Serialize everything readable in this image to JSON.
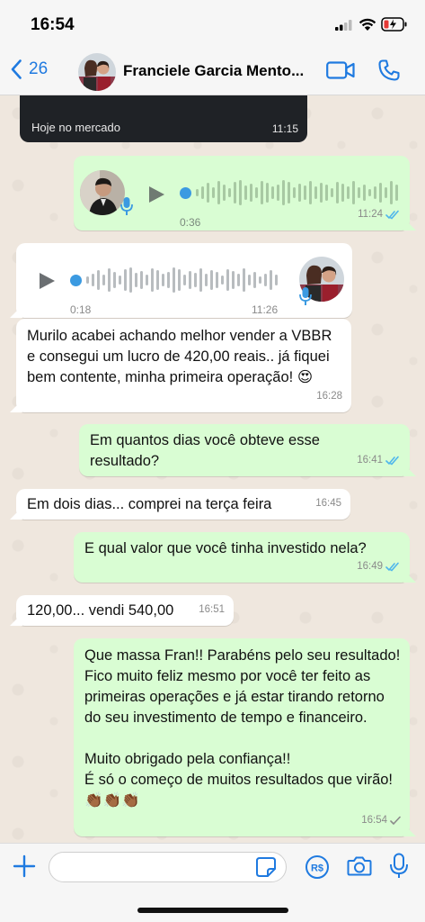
{
  "status_bar": {
    "time": "16:54"
  },
  "header": {
    "back_count": "26",
    "contact_name": "Franciele Garcia Mento..."
  },
  "messages": {
    "media": {
      "caption": "Hoje no mercado",
      "time": "11:15"
    },
    "voice_out": {
      "duration": "0:36",
      "time": "11:24"
    },
    "voice_in": {
      "duration": "0:18",
      "time": "11:26"
    },
    "m1": {
      "text": "Murilo acabei achando melhor vender a VBBR e consegui um lucro de 420,00 reais.. já fiquei bem contente, minha primeira operação! 😍",
      "time": "16:28"
    },
    "m2": {
      "text": "Em quantos dias você obteve esse resultado?",
      "time": "16:41"
    },
    "m3": {
      "text": "Em dois dias... comprei na terça feira",
      "time": "16:45"
    },
    "m4": {
      "text": "E qual valor que você tinha investido nela?",
      "time": "16:49"
    },
    "m5": {
      "text": "120,00... vendi 540,00",
      "time": "16:51"
    },
    "m6": {
      "text": "Que massa Fran!! Parabéns pelo seu resultado! Fico muito feliz mesmo por você ter feito as primeiras operações e já estar tirando retorno do seu investimento de tempo e financeiro.\n\nMuito obrigado pela confiança!!\nÉ só o começo de muitos resultados que virão! 👏🏾👏🏾👏🏾",
      "time": "16:54"
    }
  },
  "colors": {
    "accent": "#1f7ae0",
    "outgoing": "#d9fdd3",
    "incoming": "#ffffff",
    "read_tick": "#4fb6ec",
    "wave_green": "#a8c9a3"
  },
  "icons": [
    "signal-icon",
    "wifi-icon",
    "battery-charging-icon",
    "chevron-left-icon",
    "video-call-icon",
    "phone-icon",
    "play-icon",
    "mic-icon",
    "double-check-icon",
    "plus-icon",
    "sticker-icon",
    "payment-icon",
    "camera-icon"
  ]
}
